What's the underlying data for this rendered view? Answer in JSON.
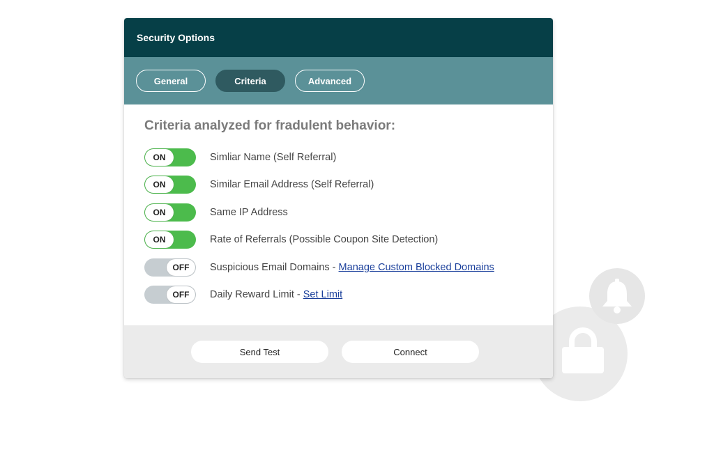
{
  "header": {
    "title": "Security Options"
  },
  "tabs": [
    {
      "label": "General",
      "active": false
    },
    {
      "label": "Criteria",
      "active": true
    },
    {
      "label": "Advanced",
      "active": false
    }
  ],
  "content": {
    "title": "Criteria analyzed for fradulent behavior:",
    "criteria": [
      {
        "state": "ON",
        "label": "Simliar Name (Self Referral)"
      },
      {
        "state": "ON",
        "label": "Similar Email Address (Self Referral)"
      },
      {
        "state": "ON",
        "label": "Same IP Address"
      },
      {
        "state": "ON",
        "label": "Rate of Referrals (Possible Coupon Site Detection)"
      },
      {
        "state": "OFF",
        "label": "Suspicious Email Domains - ",
        "link": "Manage Custom Blocked Domains"
      },
      {
        "state": "OFF",
        "label": "Daily Reward Limit - ",
        "link": "Set Limit"
      }
    ]
  },
  "footer": {
    "send_test_label": "Send Test",
    "connect_label": "Connect"
  },
  "colors": {
    "header_bg": "#063f47",
    "tab_bar_bg": "#5b9198",
    "toggle_on": "#4cbb4c",
    "toggle_off": "#c6cdd1",
    "link": "#1a3f9b"
  },
  "icons": {
    "background": [
      "lock-icon",
      "bell-icon"
    ]
  }
}
